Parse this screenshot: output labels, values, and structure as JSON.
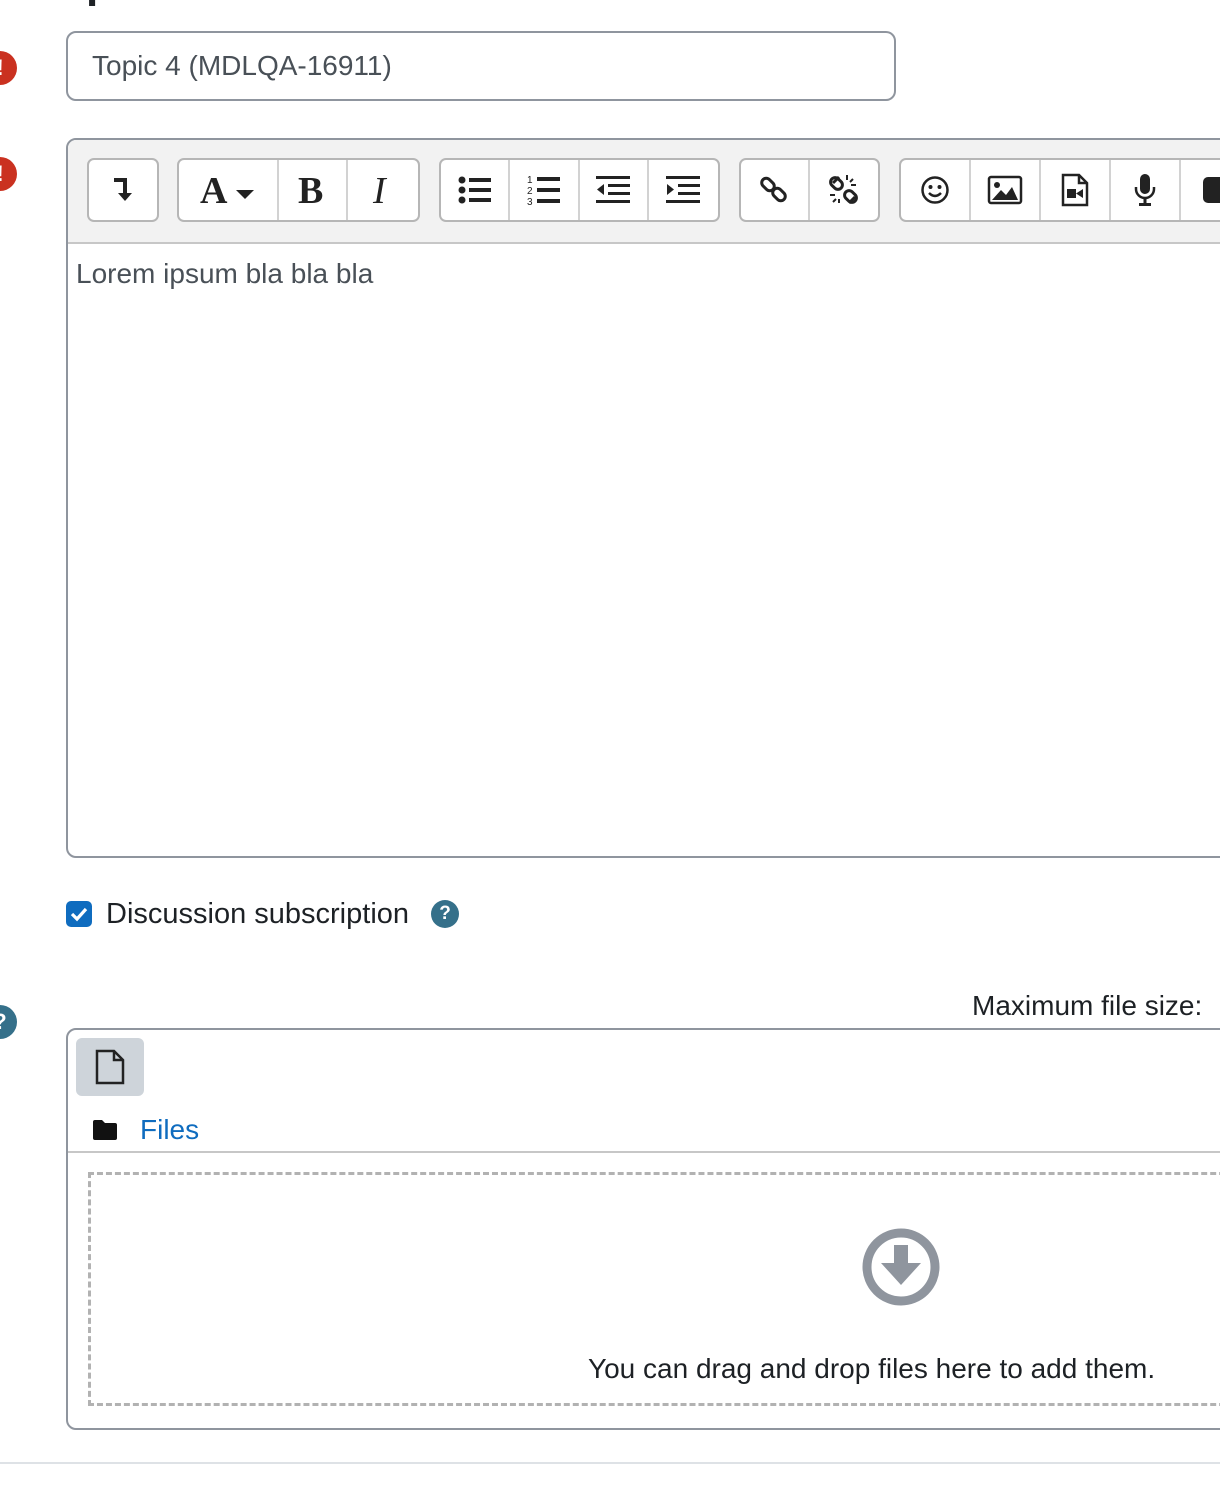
{
  "subject": {
    "value": "Topic 4 (MDLQA-16911)"
  },
  "editor": {
    "content": "Lorem ipsum bla bla bla",
    "toolbar": [
      "collapse-icon",
      "font-style-icon",
      "bold-icon",
      "italic-icon",
      "unordered-list-icon",
      "ordered-list-icon",
      "outdent-icon",
      "indent-icon",
      "link-icon",
      "unlink-icon",
      "emoji-icon",
      "image-icon",
      "video-icon",
      "microphone-icon"
    ]
  },
  "subscription": {
    "label": "Discussion subscription",
    "checked": true
  },
  "attachments": {
    "max_size_label": "Maximum file size:",
    "path_label": "Files",
    "dropzone_text": "You can drag and drop files here to add them."
  },
  "colors": {
    "required": "#ca3120",
    "help": "#35708a",
    "link": "#0f6cbf",
    "border": "#8f959e"
  }
}
